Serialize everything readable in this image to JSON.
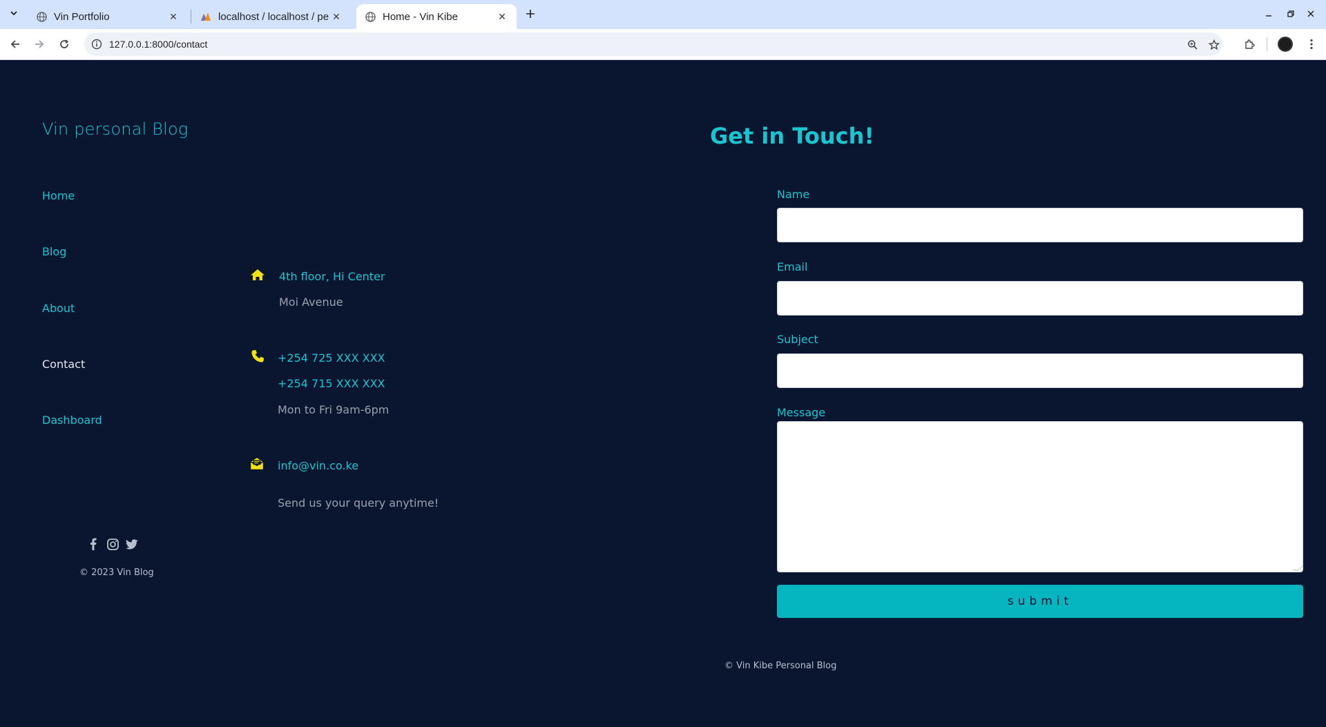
{
  "browser": {
    "tabs": [
      {
        "title": "Vin Portfolio",
        "active": false
      },
      {
        "title": "localhost / localhost / pe",
        "active": false
      },
      {
        "title": "Home - Vin Kibe",
        "active": true
      }
    ],
    "url": "127.0.0.1:8000/contact"
  },
  "sidebar": {
    "brand": "Vin personal Blog",
    "nav": [
      {
        "label": "Home",
        "active": false
      },
      {
        "label": "Blog",
        "active": false
      },
      {
        "label": "About",
        "active": false
      },
      {
        "label": "Contact",
        "active": true
      },
      {
        "label": "Dashboard",
        "active": false
      }
    ],
    "socials": [
      "facebook-icon",
      "instagram-icon",
      "twitter-icon"
    ],
    "copyright": "© 2023 Vin Blog"
  },
  "contact_info": {
    "address": {
      "line1": "4th floor, Hi Center",
      "line2": "Moi Avenue"
    },
    "phone": {
      "line1": "+254 725 XXX XXX",
      "line2": "+254 715 XXX XXX",
      "hours": "Mon to Fri 9am-6pm"
    },
    "email": {
      "address": "info@vin.co.ke",
      "note": "Send us your query anytime!"
    }
  },
  "form": {
    "heading": "Get in Touch!",
    "name_label": "Name",
    "email_label": "Email",
    "subject_label": "Subject",
    "message_label": "Message",
    "submit_label": "submit"
  },
  "footer": {
    "copyright": "© Vin Kibe Personal Blog"
  },
  "colors": {
    "background": "#0a1530",
    "accent": "#17c6d0",
    "button": "#05b5c0",
    "icon": "#f0e012"
  }
}
